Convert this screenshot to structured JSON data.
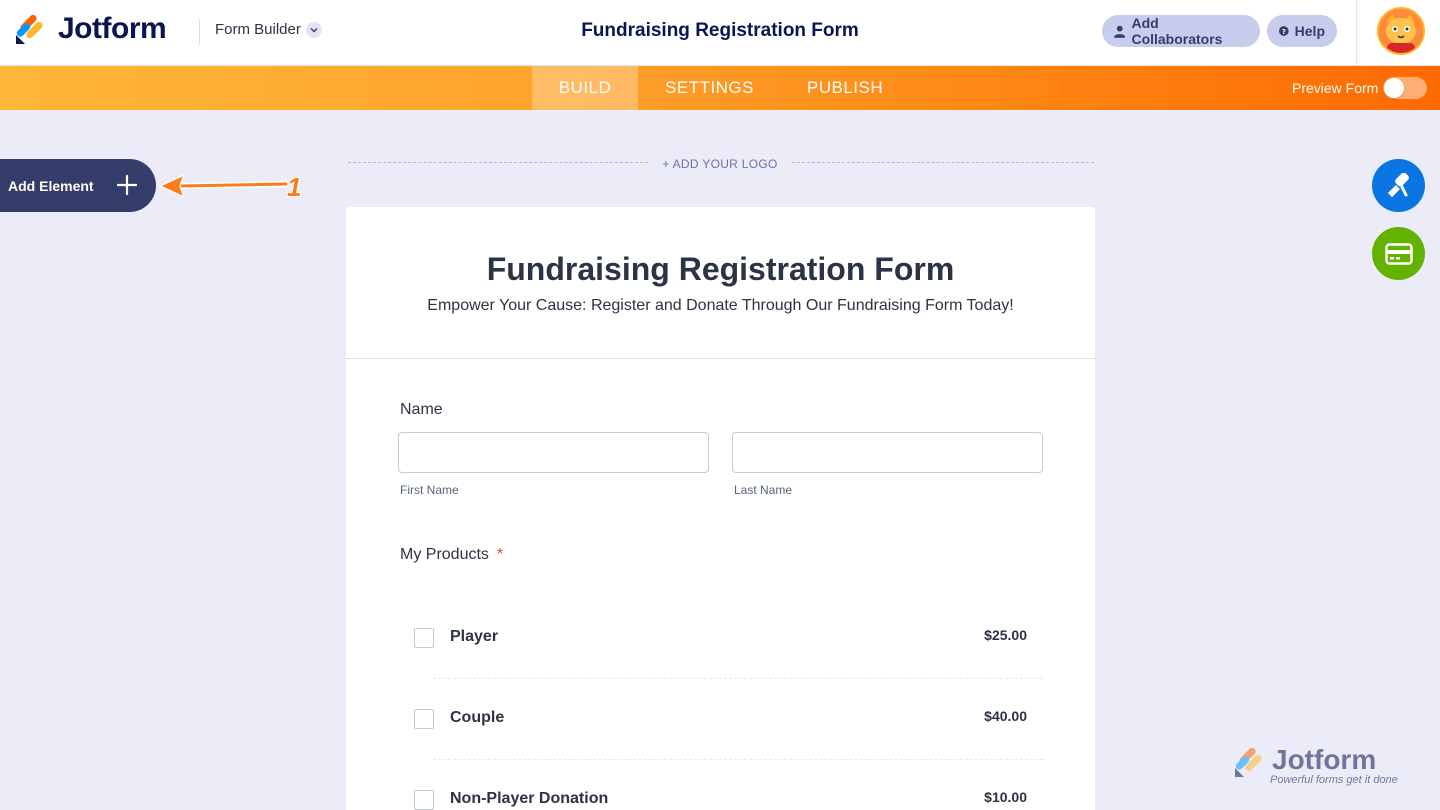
{
  "header": {
    "brand": "Jotform",
    "app_menu": "Form Builder",
    "form_title": "Fundraising Registration Form",
    "add_collaborators": "Add Collaborators",
    "help": "Help"
  },
  "nav": {
    "tabs": [
      "BUILD",
      "SETTINGS",
      "PUBLISH"
    ],
    "active_tab": "BUILD",
    "preview_label": "Preview Form",
    "preview_enabled": false
  },
  "sidebar": {
    "add_element": "Add Element",
    "annotation_number": "1"
  },
  "form": {
    "add_logo": "+ ADD YOUR LOGO",
    "title": "Fundraising Registration Form",
    "subtitle": "Empower Your Cause: Register and Donate Through Our Fundraising Form Today!",
    "name_label": "Name",
    "first_name_sublabel": "First Name",
    "last_name_sublabel": "Last Name",
    "first_name_value": "",
    "last_name_value": "",
    "products_label": "My Products",
    "required_mark": "*",
    "products": [
      {
        "name": "Player",
        "price": "$25.00",
        "checked": false
      },
      {
        "name": "Couple",
        "price": "$40.00",
        "checked": false
      },
      {
        "name": "Non-Player Donation",
        "price": "$10.00",
        "checked": false
      }
    ]
  },
  "watermark": {
    "brand": "Jotform",
    "tagline": "Powerful forms get it done"
  },
  "colors": {
    "accent_orange": "#ff6100",
    "navy": "#0a1551",
    "form_designer_blue": "#0a75e3",
    "payment_green": "#64b200"
  },
  "icons": [
    "user-icon",
    "help-icon",
    "plus-icon",
    "paint-roller-icon",
    "credit-card-icon",
    "chevron-down-icon"
  ]
}
